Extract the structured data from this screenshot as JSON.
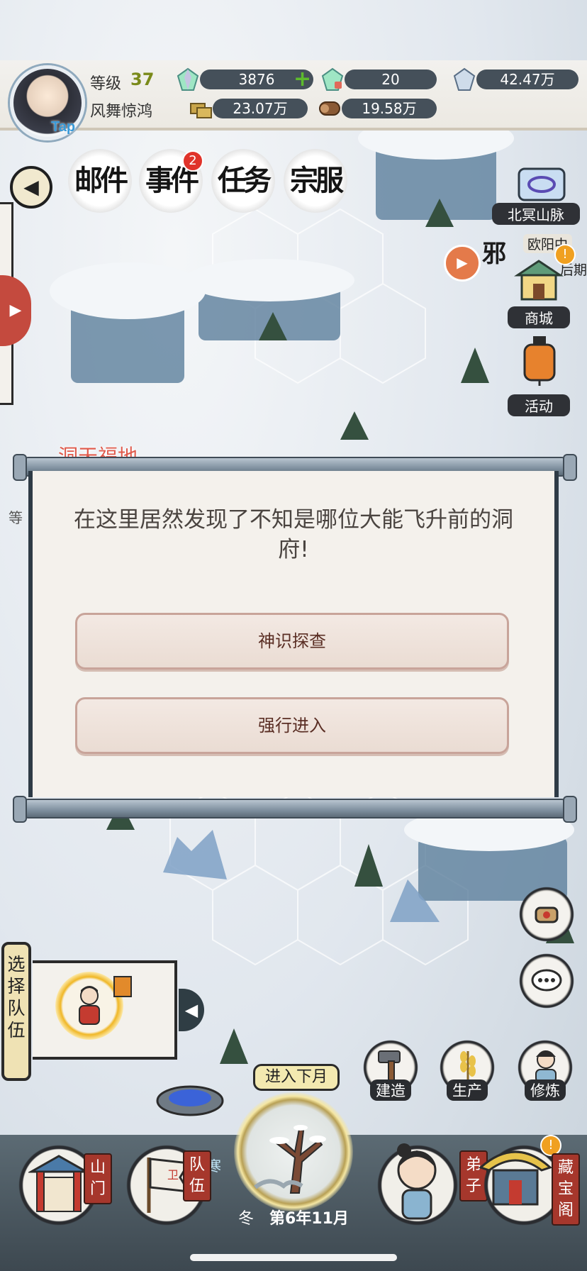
{
  "header": {
    "level_label": "等级",
    "level_value": "37",
    "player_name": "风舞惊鸿",
    "tap_label": "Tap",
    "resources": {
      "jade": "3876",
      "jade_bound": "20",
      "crystal": "42.47万",
      "ore": "23.07万",
      "wood": "19.58万"
    }
  },
  "top_menu": {
    "mail": "邮件",
    "events": "事件",
    "events_badge": "2",
    "tasks": "任务",
    "clan": "宗服"
  },
  "right_side": {
    "region": "北冥山脉",
    "event_banner": "欧阳中",
    "event_suffix": "后期",
    "evil_label": "邪",
    "shop": "商城",
    "activity": "活动"
  },
  "popup": {
    "title": "洞天福地",
    "message": "在这里居然发现了不知是哪位大能飞升前的洞府!",
    "option_probe": "神识探查",
    "option_force": "强行进入"
  },
  "team": {
    "select_label": "选择队伍"
  },
  "bottom": {
    "next_month": "进入下月",
    "season": "冬",
    "date": "第6年11月",
    "build": "建造",
    "produce": "生产",
    "cultivate": "修炼",
    "gate": "山门",
    "squad": "队伍",
    "disciple": "弟子",
    "treasury": "藏宝阁",
    "faded_left": "等",
    "faded_cold": "寒"
  },
  "colors": {
    "level_green": "#7a8a1a",
    "popup_title": "#e0594a",
    "badge_red": "#e0332a",
    "tag_red": "#a6372c"
  }
}
